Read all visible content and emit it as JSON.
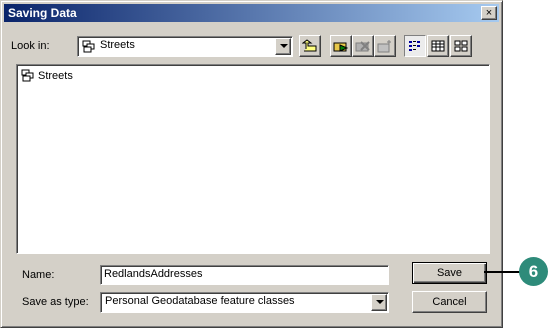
{
  "window": {
    "title": "Saving Data",
    "close_symbol": "×"
  },
  "lookin": {
    "label": "Look in:",
    "value": "Streets"
  },
  "toolbar": {
    "buttons": [
      {
        "name": "up-one-level-icon"
      },
      {
        "name": "connect-folder-icon"
      },
      {
        "name": "disconnect-folder-icon"
      },
      {
        "name": "new-folder-icon"
      },
      {
        "name": "list-view-icon",
        "pressed": true
      },
      {
        "name": "details-view-icon"
      },
      {
        "name": "thumbnails-view-icon"
      }
    ]
  },
  "list": {
    "items": [
      {
        "label": "Streets",
        "icon": "feature-dataset-icon"
      }
    ]
  },
  "name_field": {
    "label": "Name:",
    "value": "RedlandsAddresses"
  },
  "type_field": {
    "label": "Save as type:",
    "value": "Personal Geodatabase feature classes"
  },
  "buttons": {
    "save": "Save",
    "cancel": "Cancel"
  },
  "callout": {
    "number": "6"
  },
  "colors": {
    "titlebar_start": "#0a246a",
    "titlebar_end": "#a6caf0",
    "callout": "#2e8b7a"
  }
}
